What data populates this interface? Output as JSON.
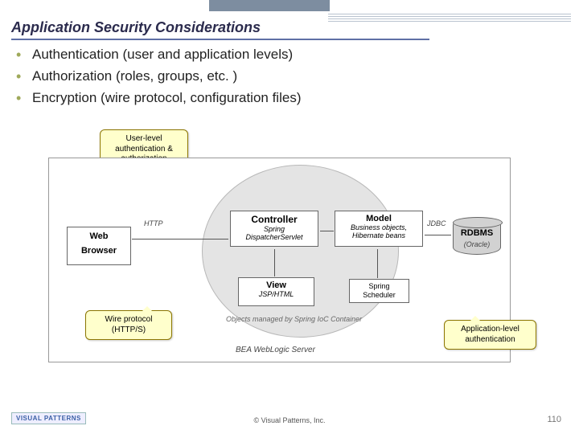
{
  "title": "Application Security Considerations",
  "bullets": [
    "Authentication (user and application levels)",
    "Authorization (roles, groups, etc. )",
    "Encryption (wire protocol, configuration files)"
  ],
  "diagram": {
    "web": {
      "l1": "Web",
      "l2": "Browser"
    },
    "controller": {
      "heading": "Controller",
      "sub1": "Spring",
      "sub2": "DispatcherServlet"
    },
    "view": {
      "heading": "View",
      "sub": "JSP/HTML"
    },
    "model": {
      "heading": "Model",
      "sub1": "Business objects,",
      "sub2": "Hibernate beans"
    },
    "scheduler": {
      "l1": "Spring",
      "l2": "Scheduler"
    },
    "db": {
      "heading": "RDBMS",
      "sub": "(Oracle)"
    },
    "http_label": "HTTP",
    "jdbc_label": "JDBC",
    "managed": "Objects managed by Spring IoC Container",
    "server": "BEA WebLogic Server"
  },
  "callouts": {
    "c1": "User-level authentication & authorization",
    "c2": "Wire protocol (HTTP/S)",
    "c3": "Application-level authentication"
  },
  "footer": "© Visual Patterns, Inc.",
  "logo": "VISUAL PATTERNS",
  "page": "110"
}
